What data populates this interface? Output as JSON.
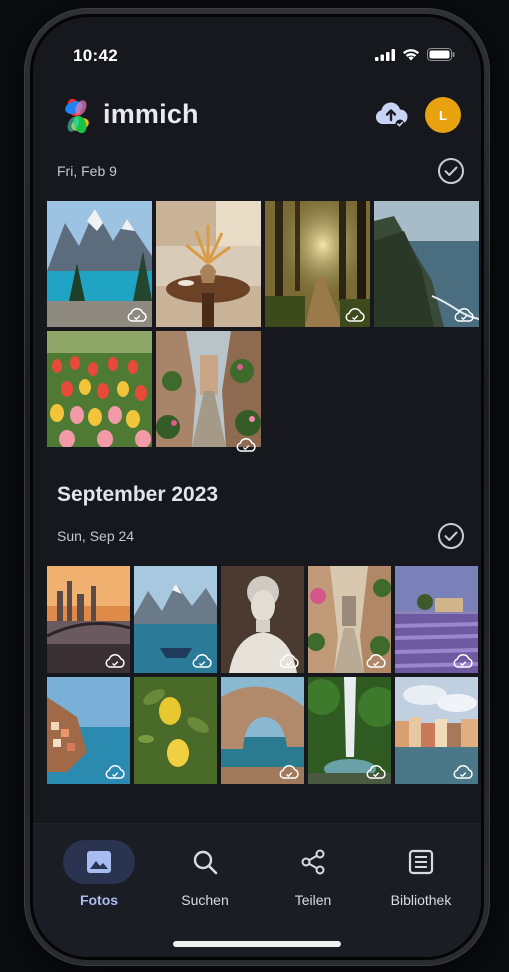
{
  "status_bar": {
    "time": "10:42"
  },
  "header": {
    "app_name": "immich",
    "avatar_initial": "L"
  },
  "sections": [
    {
      "date": "Fri, Feb 9"
    },
    {
      "month": "September 2023",
      "date": "Sun, Sep 24"
    }
  ],
  "photos_feb": [
    {
      "subject": "mountain lake"
    },
    {
      "subject": "living room table"
    },
    {
      "subject": "forest path"
    },
    {
      "subject": "coastal cliffs"
    },
    {
      "subject": "tulip field"
    },
    {
      "subject": "flowered alley"
    }
  ],
  "photos_sep": [
    {
      "subject": "city bridge sunset"
    },
    {
      "subject": "boat on fjord"
    },
    {
      "subject": "marble bust"
    },
    {
      "subject": "village street"
    },
    {
      "subject": "lavender field"
    },
    {
      "subject": "seaside village"
    },
    {
      "subject": "lemons"
    },
    {
      "subject": "rock arch"
    },
    {
      "subject": "waterfall"
    },
    {
      "subject": "harbor houses"
    }
  ],
  "nav": [
    {
      "label": "Fotos",
      "icon": "image-icon",
      "active": true
    },
    {
      "label": "Suchen",
      "icon": "search-icon",
      "active": false
    },
    {
      "label": "Teilen",
      "icon": "share-icon",
      "active": false
    },
    {
      "label": "Bibliothek",
      "icon": "library-icon",
      "active": false
    }
  ],
  "colors": {
    "accent": "#a9bcf2",
    "avatar": "#e8a10f",
    "background": "#17181d"
  }
}
